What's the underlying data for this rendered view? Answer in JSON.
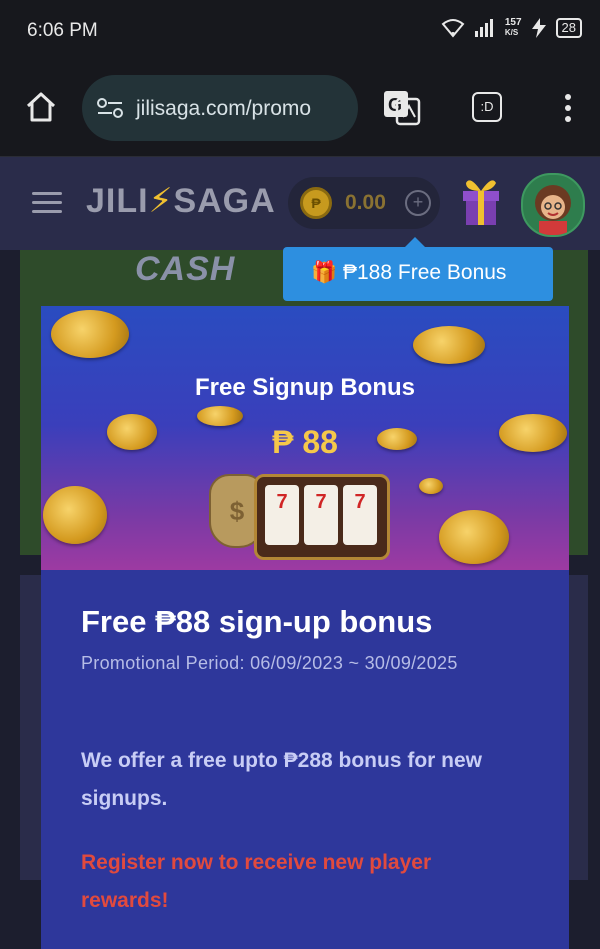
{
  "status_bar": {
    "time": "6:06 PM",
    "speed_value": "157",
    "speed_unit": "K/S",
    "battery": "28"
  },
  "browser": {
    "url": "jilisaga.com/promo",
    "tab_label": ":D"
  },
  "site_header": {
    "logo_left": "JILI",
    "logo_right": "SAGA",
    "balance": "0.00",
    "coin_symbol": "₱"
  },
  "tooltip": {
    "text": "₱188 Free Bonus",
    "icon": "gift-icon"
  },
  "background_banner": {
    "text": "CASH"
  },
  "promo": {
    "image_heading": "Free Signup Bonus",
    "image_amount": "₱ 88",
    "title": "Free ₱88 sign-up bonus",
    "period": "Promotional Period: 06/09/2023 ~ 30/09/2025",
    "description": "We offer a free upto ₱288 bonus for new signups.",
    "cta": "Register now to receive new player rewards!"
  },
  "colors": {
    "accent_blue": "#2d8fe0",
    "promo_bg": "#2e379b",
    "cta_red": "#e14a3e",
    "gold": "#f5c84a"
  }
}
